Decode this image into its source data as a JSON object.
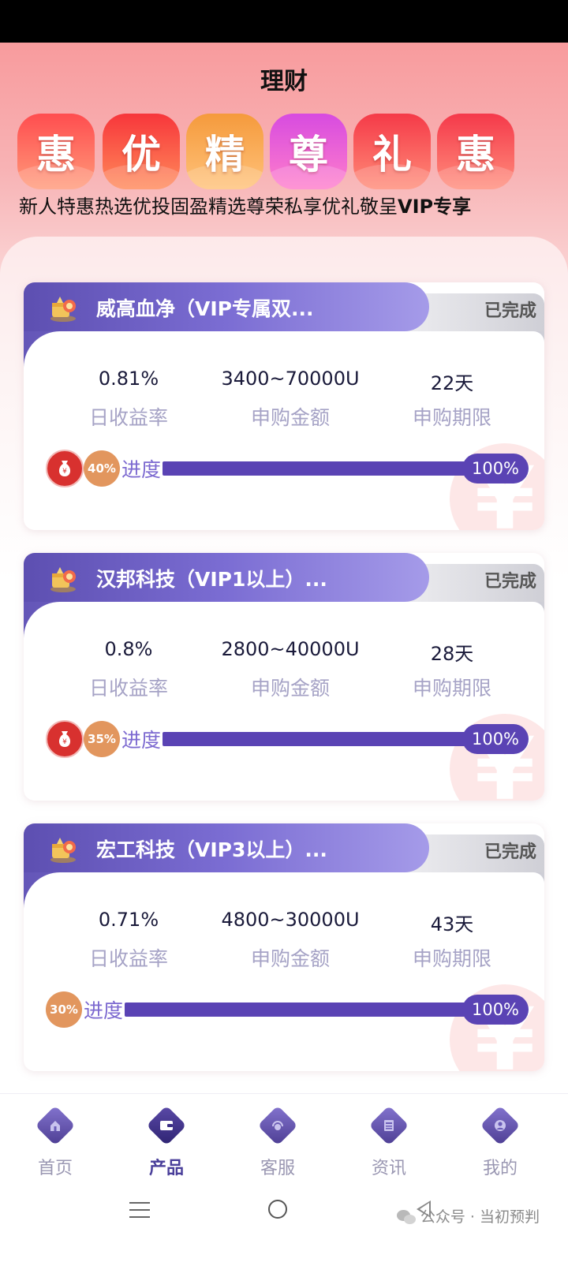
{
  "page": {
    "title": "理财"
  },
  "promo": {
    "badges": [
      {
        "char": "惠",
        "color_from": "#ff4d4f",
        "color_to": "#ff9a7a"
      },
      {
        "char": "优",
        "color_from": "#f7363b",
        "color_to": "#ff8a5a"
      },
      {
        "char": "精",
        "color_from": "#f59a3c",
        "color_to": "#ffc27a"
      },
      {
        "char": "尊",
        "color_from": "#d74be0",
        "color_to": "#ff7ecb"
      },
      {
        "char": "礼",
        "color_from": "#f53a48",
        "color_to": "#ff8b78"
      },
      {
        "char": "惠",
        "color_from": "#f5394a",
        "color_to": "#ff8d7c"
      }
    ],
    "caption_main": "新人特惠热选优投固盈精选尊荣私享优礼敬呈",
    "caption_bold": "VIP专享"
  },
  "products": [
    {
      "title": "威高血净（VIP专属双...",
      "status": "已完成",
      "daily_rate": "0.81%",
      "daily_rate_label": "日收益率",
      "amount": "3400~70000U",
      "amount_label": "申购金额",
      "term": "22天",
      "term_label": "申购期限",
      "show_money_icon": true,
      "pct_bubble": "40%",
      "progress_label": "进度",
      "progress_value": 1.0,
      "progress_text": "100%"
    },
    {
      "title": "汉邦科技（VIP1以上）...",
      "status": "已完成",
      "daily_rate": "0.8%",
      "daily_rate_label": "日收益率",
      "amount": "2800~40000U",
      "amount_label": "申购金额",
      "term": "28天",
      "term_label": "申购期限",
      "show_money_icon": true,
      "pct_bubble": "35%",
      "progress_label": "进度",
      "progress_value": 1.0,
      "progress_text": "100%"
    },
    {
      "title": "宏工科技（VIP3以上）...",
      "status": "已完成",
      "daily_rate": "0.71%",
      "daily_rate_label": "日收益率",
      "amount": "4800~30000U",
      "amount_label": "申购金额",
      "term": "43天",
      "term_label": "申购期限",
      "show_money_icon": false,
      "pct_bubble": "30%",
      "progress_label": "进度",
      "progress_value": 1.0,
      "progress_text": "100%"
    }
  ],
  "nav": {
    "items": [
      {
        "label": "首页",
        "icon": "home-icon",
        "active": false
      },
      {
        "label": "产品",
        "icon": "wallet-icon",
        "active": true
      },
      {
        "label": "客服",
        "icon": "headset-icon",
        "active": false
      },
      {
        "label": "资讯",
        "icon": "news-icon",
        "active": false
      },
      {
        "label": "我的",
        "icon": "profile-icon",
        "active": false
      }
    ]
  },
  "watermark": {
    "symbol": "¥",
    "credit": "公众号 · 当初预判"
  },
  "colors": {
    "accent": "#5a43b4",
    "status_grey": "#555555",
    "label_lavender": "#a6a3c6"
  }
}
